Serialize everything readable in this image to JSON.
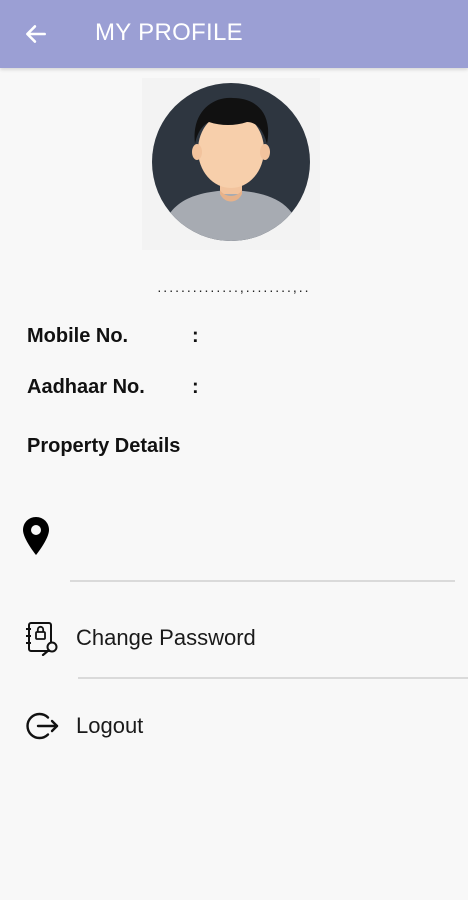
{
  "header": {
    "title": "MY PROFILE",
    "back_icon": "arrow-left-icon",
    "background": "#9b9fd4"
  },
  "profile": {
    "avatar_icon": "user-avatar-icon",
    "name": "..............,........,.."
  },
  "info": {
    "mobile_label": "Mobile No.",
    "mobile_colon": ":",
    "mobile_value": "",
    "aadhaar_label": "Aadhaar No.",
    "aadhaar_colon": ":",
    "aadhaar_value": ""
  },
  "property": {
    "title": "Property Details",
    "location_icon": "map-pin-icon",
    "location_text": ""
  },
  "menu": {
    "change_password_label": "Change Password",
    "change_password_icon": "password-book-icon",
    "logout_label": "Logout",
    "logout_icon": "logout-icon"
  }
}
